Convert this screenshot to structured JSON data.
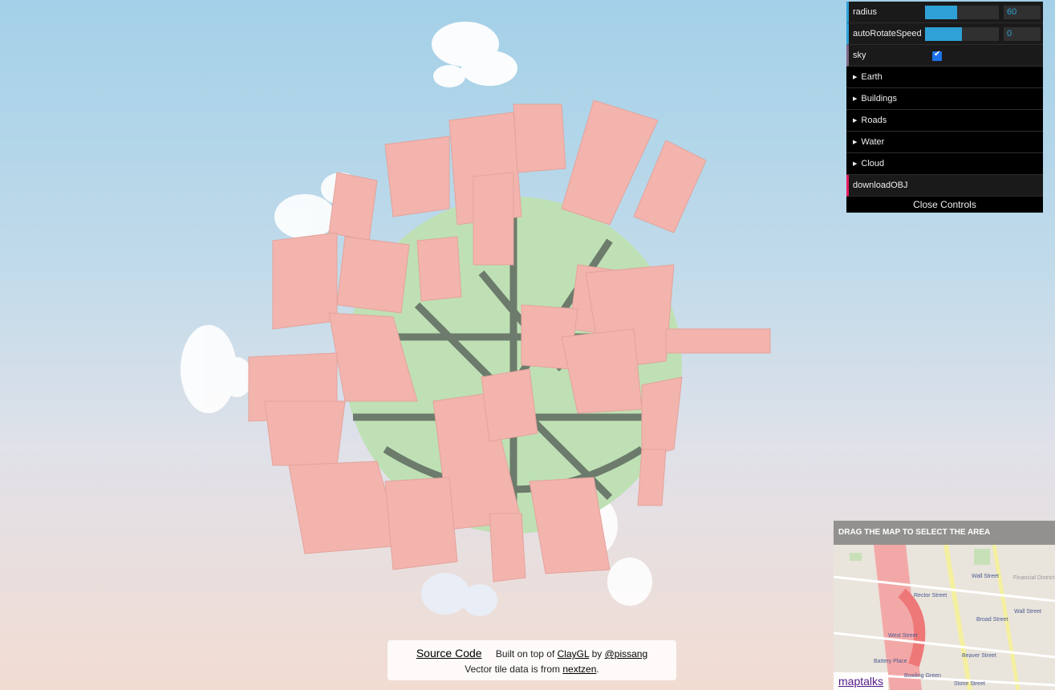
{
  "gui": {
    "controls": [
      {
        "label": "radius",
        "type": "number",
        "value": "60",
        "fill": 0.44
      },
      {
        "label": "autoRotateSpeed",
        "type": "number",
        "value": "0",
        "fill": 0.5
      },
      {
        "label": "sky",
        "type": "boolean",
        "checked": true
      }
    ],
    "folders": [
      "Earth",
      "Buildings",
      "Roads",
      "Water",
      "Cloud"
    ],
    "download_label": "downloadOBJ",
    "close_label": "Close Controls"
  },
  "minimap": {
    "header": "DRAG THE MAP TO SELECT THE AREA",
    "labels": [
      "Wall Street",
      "Financial District",
      "Rector Street",
      "Wall Street",
      "Broad Street",
      "Bowling Green",
      "Battery Place",
      "West Street",
      "Stone Street",
      "Beaver Street"
    ],
    "attribution": "maptalks"
  },
  "info": {
    "source_code": "Source Code",
    "built_prefix": "Built on top of",
    "claygl": "ClayGL",
    "by": "by",
    "author": "@pissang",
    "line2_prefix": "Vector tile data is from",
    "nextzen": "nextzen",
    "line2_suffix": "."
  },
  "colors": {
    "building": "#f2b4ad",
    "ground": "#bfe0b4",
    "road": "#5e6a60",
    "cloud": "#ffffff",
    "accent": "#2fa1d6"
  }
}
